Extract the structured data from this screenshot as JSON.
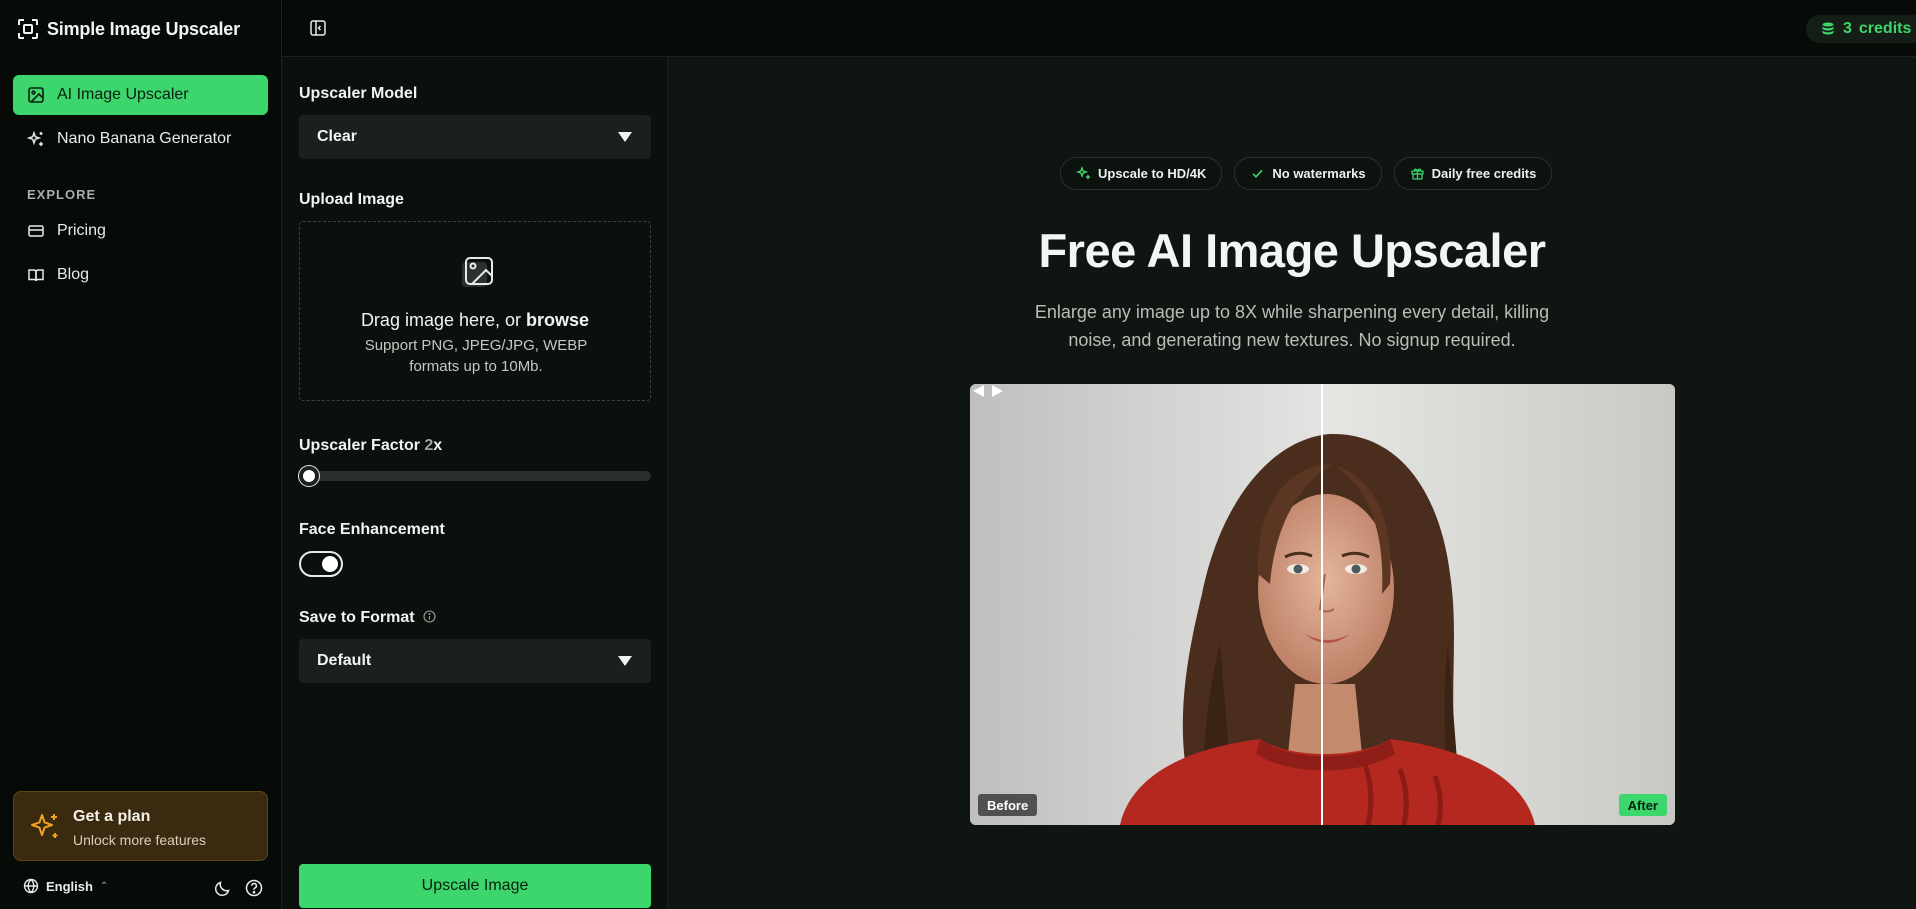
{
  "app": {
    "title": "Simple Image Upscaler"
  },
  "sidebar": {
    "nav": [
      {
        "label": "AI Image Upscaler",
        "icon": "image-icon",
        "active": true
      },
      {
        "label": "Nano Banana Generator",
        "icon": "sparkles-icon",
        "active": false
      }
    ],
    "section_label": "EXPLORE",
    "explore": [
      {
        "label": "Pricing",
        "icon": "credit-card-icon"
      },
      {
        "label": "Blog",
        "icon": "book-icon"
      }
    ],
    "plan_card": {
      "title": "Get a plan",
      "subtitle": "Unlock more features",
      "icon": "sparkle-icon"
    },
    "footer": {
      "language": "English",
      "icons": [
        "moon-icon",
        "help-icon"
      ]
    }
  },
  "topbar": {
    "credits_count": "3",
    "credits_label": "credits"
  },
  "controls": {
    "model_label": "Upscaler Model",
    "model_value": "Clear",
    "upload_label": "Upload Image",
    "upload_text": "Drag image here, or ",
    "upload_link": "browse",
    "upload_hint": "Support PNG, JPEG/JPG, WEBP formats up to 10Mb.",
    "factor_label": "Upscaler Factor ",
    "factor_value": "2",
    "factor_unit": "x",
    "factor_slider_fraction": 0,
    "face_label": "Face Enhancement",
    "face_enabled": true,
    "format_label": "Save to Format",
    "format_value": "Default",
    "submit_label": "Upscale Image"
  },
  "hero": {
    "badges": [
      {
        "label": "Upscale to HD/4K",
        "icon": "sparkles-icon"
      },
      {
        "label": "No watermarks",
        "icon": "check-icon"
      },
      {
        "label": "Daily free credits",
        "icon": "gift-icon"
      }
    ],
    "title": "Free AI Image Upscaler",
    "subtitle": "Enlarge any image up to 8X while sharpening every detail, killing noise, and generating new textures. No signup required.",
    "compare": {
      "before_label": "Before",
      "after_label": "After"
    }
  },
  "colors": {
    "accent": "#3dd66c",
    "background": "#0c110d",
    "plan_card": "#3a2a10"
  }
}
